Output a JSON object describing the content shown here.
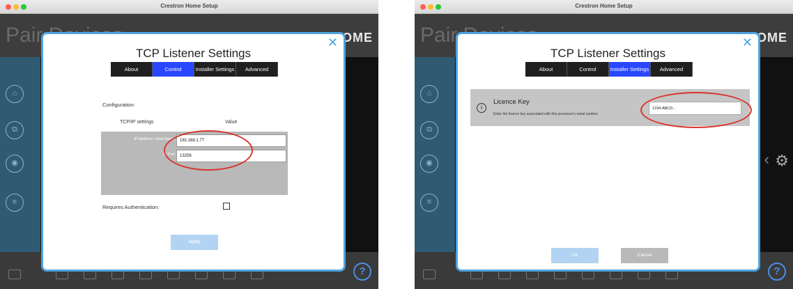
{
  "window": {
    "title": "Crestron Home Setup"
  },
  "app": {
    "page_heading": "Pair Devices",
    "brand": "CRESTRON HOME"
  },
  "colors": {
    "accent": "#2a47ff",
    "dialog_border": "#4fa3e0",
    "annotation": "#d9342b",
    "sidebar": "#2f5a72"
  },
  "dialog": {
    "title": "TCP Listener Settings",
    "tabs": [
      {
        "label": "About"
      },
      {
        "label": "Control"
      },
      {
        "label": "Installer Settings"
      },
      {
        "label": "Advanced"
      }
    ],
    "close_icon": "close-x-icon"
  },
  "control_tab": {
    "configuration_label": "Configuration:",
    "column_headers": [
      "TCP/IP settings",
      "Value"
    ],
    "rows": [
      {
        "label": "IP Address / Host Name",
        "value": "192.168.1.77"
      },
      {
        "label": "IP Port",
        "value": "13256"
      }
    ],
    "requires_auth_label": "Requires Authentication:",
    "requires_auth_checked": false,
    "apply_label": "Apply"
  },
  "installer_tab": {
    "licence_title": "Licence Key",
    "licence_desc": "Enter the licence key associated with this processor's serial number.",
    "licence_value": "1234-ABCD...",
    "ok_label": "OK",
    "cancel_label": "Cancel"
  },
  "help_label": "?"
}
